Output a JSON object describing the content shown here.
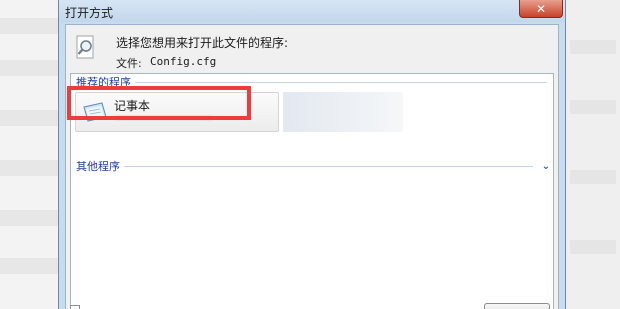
{
  "window": {
    "title": "打开方式",
    "close_glyph": "✕"
  },
  "dialog": {
    "prompt": "选择您想用来打开此文件的程序:",
    "file_label": "文件:",
    "file_name": "Config.cfg"
  },
  "groups": {
    "recommended": "推荐的程序",
    "other": "其他程序",
    "other_expand_glyph": "⌄"
  },
  "programs": [
    {
      "name": "记事本",
      "icon": "notepad-icon"
    }
  ],
  "colors": {
    "highlight": "#ee3b3b",
    "group_text": "#1e3f9a",
    "close_button": "#c7432b"
  },
  "icons": {
    "header": "magnifier-icon",
    "close": "close-icon",
    "chevron": "chevron-down-icon"
  }
}
